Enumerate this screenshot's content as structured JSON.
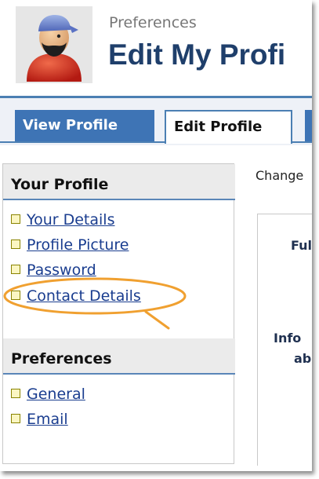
{
  "header": {
    "subtitle": "Preferences",
    "title": "Edit My Profi"
  },
  "tabs": [
    {
      "label": "View Profile",
      "active": false
    },
    {
      "label": "Edit Profile",
      "active": true
    }
  ],
  "sidebar": {
    "sections": [
      {
        "title": "Your Profile",
        "items": [
          {
            "label": "Your Details"
          },
          {
            "label": "Profile Picture"
          },
          {
            "label": "Password"
          },
          {
            "label": "Contact Details",
            "highlighted": true
          }
        ]
      },
      {
        "title": "Preferences",
        "items": [
          {
            "label": "General"
          },
          {
            "label": "Email"
          }
        ]
      }
    ]
  },
  "main": {
    "intro_text": "Change",
    "labels": [
      "Ful",
      "Info",
      "ab"
    ]
  },
  "colors": {
    "accent_blue": "#3e74b5",
    "title_navy": "#1f3f6b",
    "link_blue": "#1a3d8f",
    "highlight_orange": "#f0a030",
    "bullet_fill": "#fbf6c2"
  },
  "icons": {
    "avatar": "pirate-user-avatar-icon",
    "bullet": "square-bullet-icon"
  }
}
